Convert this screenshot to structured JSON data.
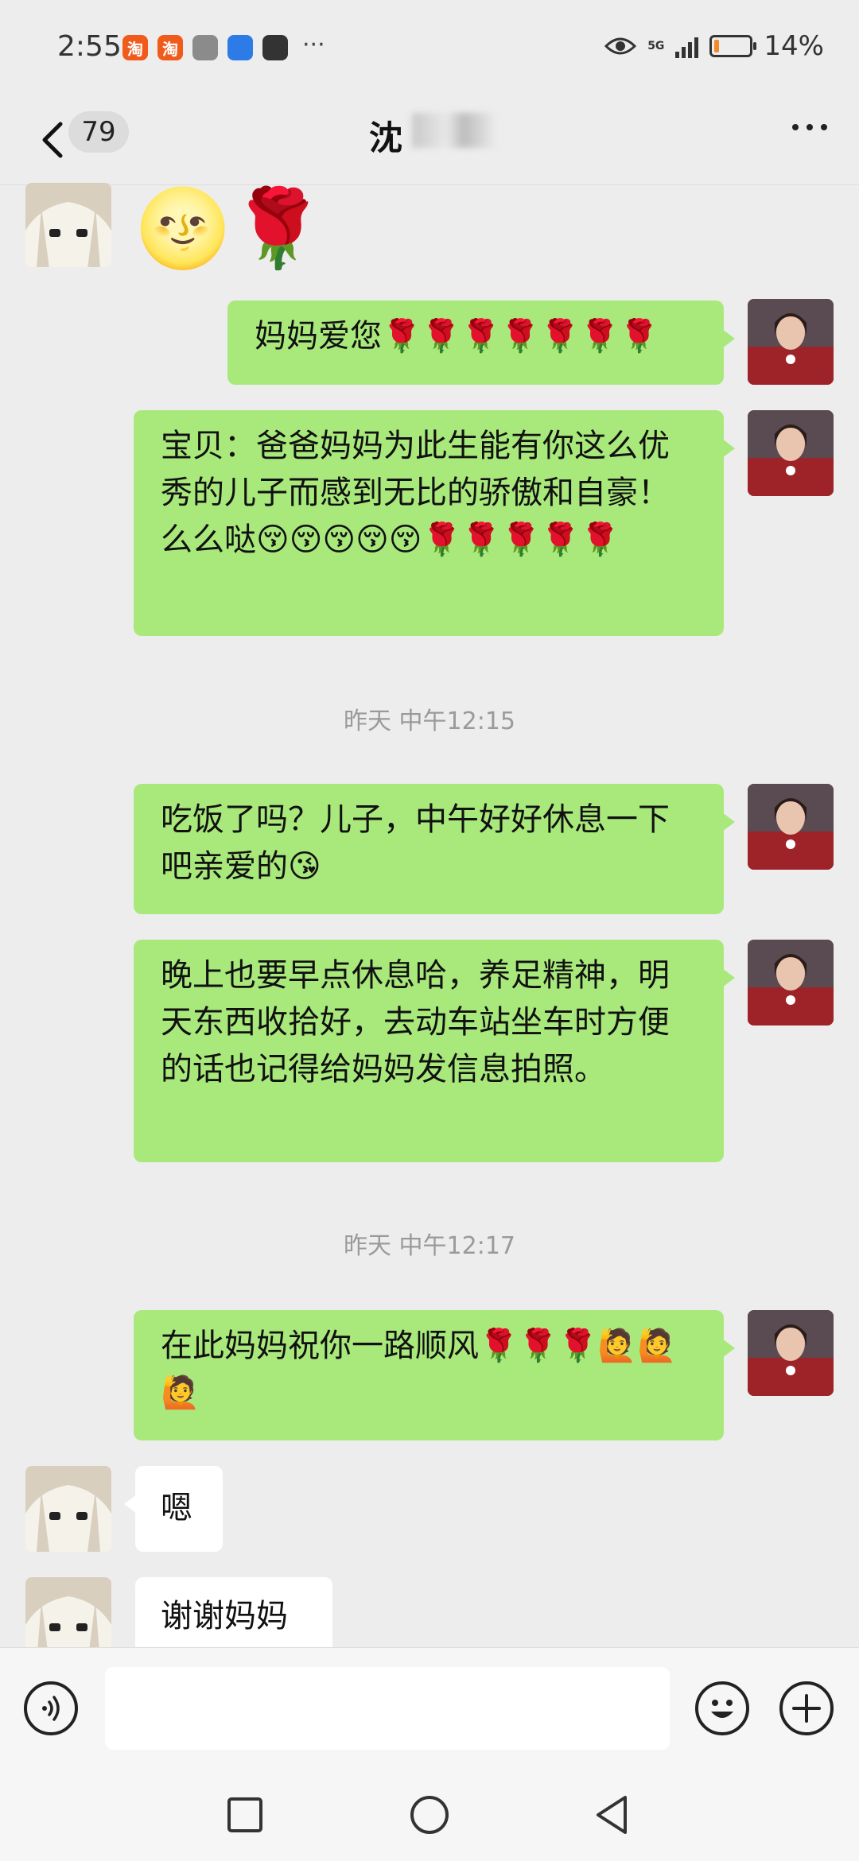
{
  "status": {
    "time": "2:55",
    "notif_icons": [
      "taobao-icon",
      "taobao-icon",
      "gallery-icon",
      "app-icon",
      "bag-icon"
    ],
    "notif_labels": [
      "淘",
      "淘",
      "",
      "",
      ""
    ],
    "overflow": "···",
    "network": "5G",
    "battery_level": 0.14,
    "battery_text": "14%"
  },
  "header": {
    "back_count": "79",
    "title": "沈",
    "menu_icon": "more-dots-icon"
  },
  "messages": [
    {
      "side": "in",
      "emoji": "🌝🌹"
    },
    {
      "side": "out",
      "text": "妈妈爱您🌹🌹🌹🌹🌹🌹🌹"
    },
    {
      "side": "out",
      "text": "宝贝：爸爸妈妈为此生能有你这么优秀的儿子而感到无比的骄傲和自豪！么么哒😚😚😚😚😚🌹🌹🌹🌹🌹"
    },
    {
      "timestamp": "昨天 中午12:15"
    },
    {
      "side": "out",
      "text": "吃饭了吗？儿子，中午好好休息一下吧亲爱的😘"
    },
    {
      "side": "out",
      "text": "晚上也要早点休息哈，养足精神，明天东西收拾好，去动车站坐车时方便的话也记得给妈妈发信息拍照。"
    },
    {
      "timestamp": "昨天 中午12:17"
    },
    {
      "side": "out",
      "text": "在此妈妈祝你一路顺风🌹🌹🌹🙋🙋🙋"
    },
    {
      "side": "in",
      "text": "嗯"
    },
    {
      "side": "in",
      "text": "谢谢妈妈"
    }
  ],
  "input_bar": {
    "voice_icon": "voice-icon",
    "emoji_icon": "emoji-icon",
    "plus_icon": "plus-icon"
  },
  "colors": {
    "outgoing_bubble": "#a9e97c",
    "incoming_bubble": "#ffffff",
    "background": "#ededed"
  }
}
